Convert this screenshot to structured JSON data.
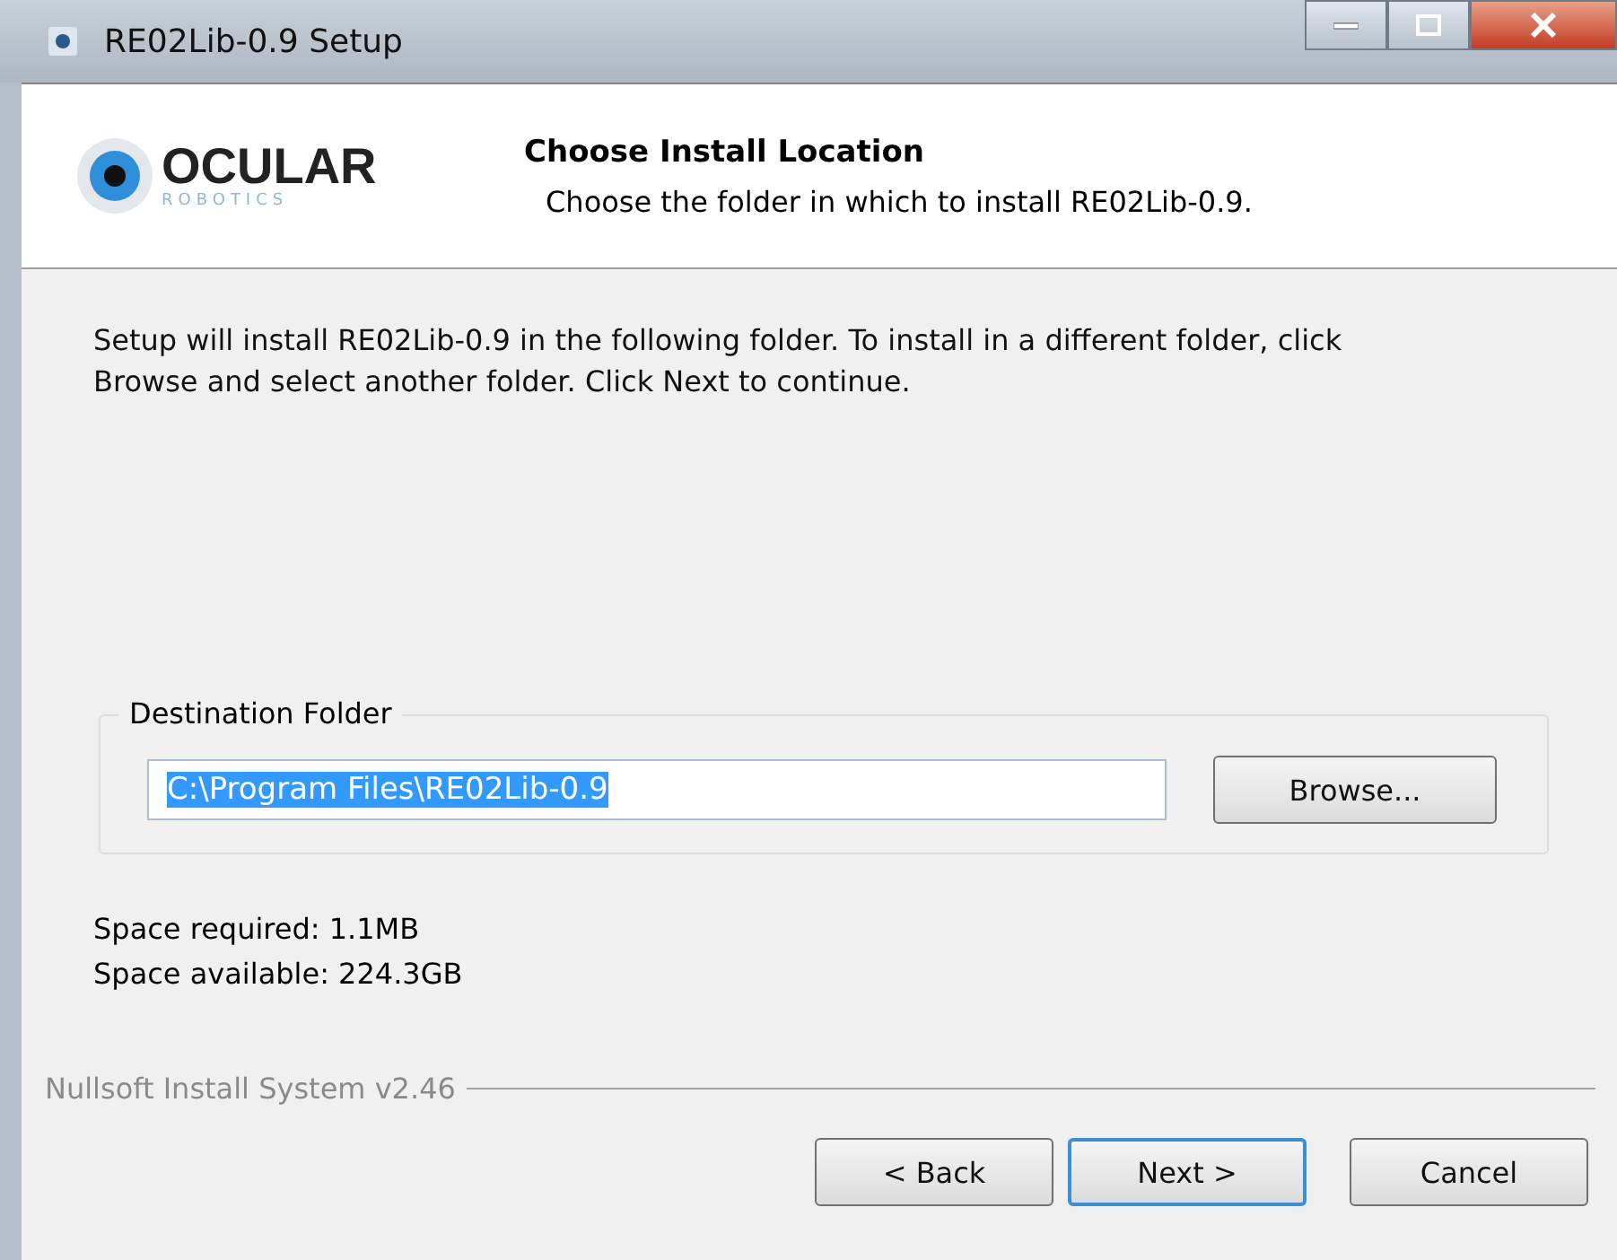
{
  "window": {
    "title": "RE02Lib-0.9 Setup"
  },
  "header": {
    "logo": {
      "name": "OCULAR",
      "subtitle": "ROBOTICS"
    },
    "title": "Choose Install Location",
    "subtitle": "Choose the folder in which to install RE02Lib-0.9."
  },
  "intro": "Setup will install RE02Lib-0.9 in the following folder. To install in a different folder, click Browse and select another folder. Click Next to continue.",
  "destination": {
    "label": "Destination Folder",
    "value": "C:\\Program Files\\RE02Lib-0.9",
    "text_selected": true,
    "browse": "Browse..."
  },
  "space": [
    "Space required: 1.1MB",
    "Space available: 224.3GB"
  ],
  "branding": "Nullsoft Install System v2.46",
  "buttons": [
    {
      "label": "< Back",
      "default": false
    },
    {
      "label": "Next >",
      "default": true
    },
    {
      "label": "Cancel",
      "default": false
    }
  ]
}
